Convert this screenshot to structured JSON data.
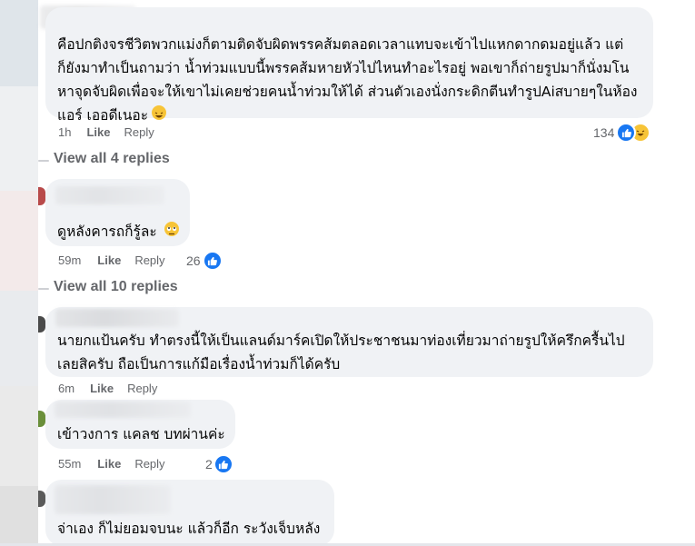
{
  "colors": {
    "bubble": "#f0f2f5",
    "meta_text": "#65676b",
    "like_blue": "#1877f2",
    "haha_yellow": "#f7c437"
  },
  "comments": [
    {
      "text_lines": [
        "คือปกติงจรชีวิตพวกแม่งก็ตามติดจับผิดพรรคส้มตลอดเวลาแทบจะเข้าไปแหกดากดมอยู่แล้ว แต่",
        "ก็ยังมาทำเป็นถามว่า น้ำท่วมแบบนี้พรรคส้มหายหัวไปไหนทำอะไรอยู่ พอเขาก็ถ่ายรูปมาก็นั่งมโน",
        "หาจุดจับผิดเพื่อจะให้เขาไม่เคยช่วยคนน้ำท่วมให้ได้ ส่วนตัวเองนั่งกระดิกตีนทำรูปAiสบายๆในห้อง",
        "แอร์ เออดีเนอะ"
      ],
      "emoji": "laughing-emoji",
      "time": "1h",
      "like_label": "Like",
      "reply_label": "Reply",
      "reaction_count": "134",
      "reaction_icons": [
        "like-icon",
        "haha-icon"
      ]
    },
    {
      "text_lines": [
        "ดูหลังคารถก็รู้ละ"
      ],
      "emoji": "rolling-eyes-emoji",
      "time": "59m",
      "like_label": "Like",
      "reply_label": "Reply",
      "reaction_count": "26",
      "reaction_icons": [
        "like-icon"
      ]
    },
    {
      "text_lines": [
        "นายกแป้นครับ ทำตรงนี้ให้เป็นแลนด์มาร์คเปิดให้ประชาชนมาท่องเที่ยวมาถ่ายรูปให้ครึกครื้นไป",
        "เลยสิครับ ถือเป็นการแก้มือเรื่องน้ำท่วมก็ได้ครับ"
      ],
      "time": "6m",
      "like_label": "Like",
      "reply_label": "Reply"
    },
    {
      "text_lines": [
        "เข้าวงการ แคลช บทผ่านค่ะ"
      ],
      "time": "55m",
      "like_label": "Like",
      "reply_label": "Reply",
      "reaction_count": "2",
      "reaction_icons": [
        "like-icon"
      ]
    },
    {
      "text_lines": [
        "จ่าเอง ก็ไม่ยอมจบนะ แล้วก็อีก ระวังเจ็บหลัง"
      ]
    }
  ],
  "view_replies": [
    "View all 4 replies",
    "View all 10 replies"
  ]
}
